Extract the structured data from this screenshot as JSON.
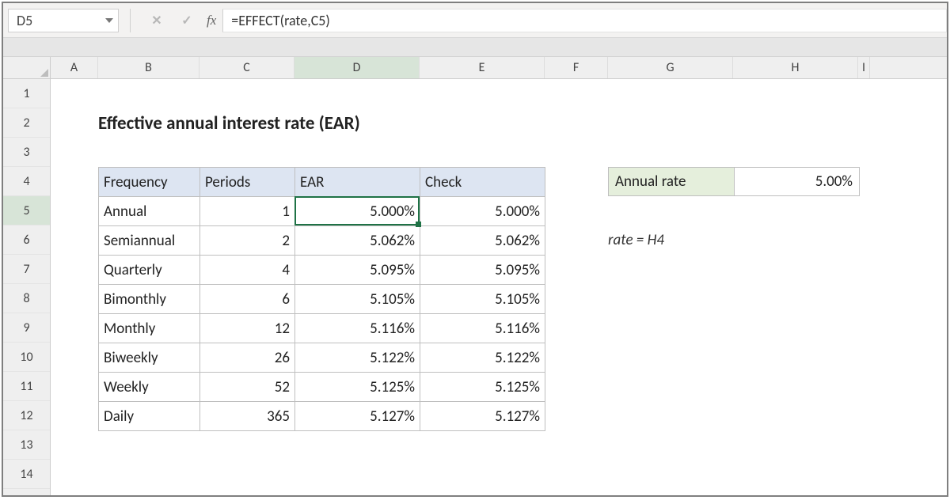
{
  "name_box": {
    "value": "D5"
  },
  "formula_bar": {
    "formula": "=EFFECT(rate,C5)",
    "fx_label": "fx"
  },
  "columns": [
    "A",
    "B",
    "C",
    "D",
    "E",
    "F",
    "G",
    "H",
    "I"
  ],
  "active_col": "D",
  "rows": [
    "1",
    "2",
    "3",
    "4",
    "5",
    "6",
    "7",
    "8",
    "9",
    "10",
    "11",
    "12",
    "13",
    "14"
  ],
  "active_row": "5",
  "title": "Effective annual interest rate (EAR)",
  "table": {
    "headers": {
      "frequency": "Frequency",
      "periods": "Periods",
      "ear": "EAR",
      "check": "Check"
    },
    "rows": [
      {
        "frequency": "Annual",
        "periods": "1",
        "ear": "5.000%",
        "check": "5.000%"
      },
      {
        "frequency": "Semiannual",
        "periods": "2",
        "ear": "5.062%",
        "check": "5.062%"
      },
      {
        "frequency": "Quarterly",
        "periods": "4",
        "ear": "5.095%",
        "check": "5.095%"
      },
      {
        "frequency": "Bimonthly",
        "periods": "6",
        "ear": "5.105%",
        "check": "5.105%"
      },
      {
        "frequency": "Monthly",
        "periods": "12",
        "ear": "5.116%",
        "check": "5.116%"
      },
      {
        "frequency": "Biweekly",
        "periods": "26",
        "ear": "5.122%",
        "check": "5.122%"
      },
      {
        "frequency": "Weekly",
        "periods": "52",
        "ear": "5.125%",
        "check": "5.125%"
      },
      {
        "frequency": "Daily",
        "periods": "365",
        "ear": "5.127%",
        "check": "5.127%"
      }
    ]
  },
  "rate": {
    "label": "Annual rate",
    "value": "5.00%"
  },
  "note": "rate = H4",
  "icons": {
    "cancel": "✕",
    "enter": "✓"
  }
}
